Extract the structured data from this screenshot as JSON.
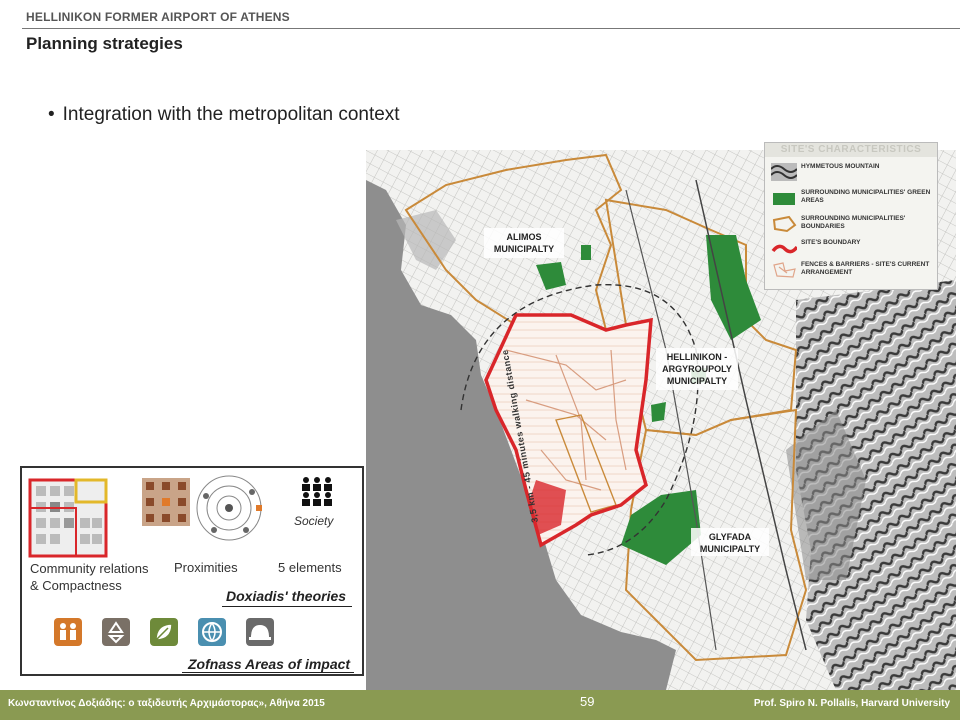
{
  "header": {
    "title": "HELLINIKON FORMER AIRPORT OF ATHENS",
    "subtitle": "Planning strategies"
  },
  "bullet": {
    "text": "Integration with the metropolitan context"
  },
  "map": {
    "labels": {
      "alimos": [
        "ALIMOS",
        "MUNICIPALTY"
      ],
      "hellinikon": [
        "HELLINIKON -",
        "ARGYROUPOLY",
        "MUNICIPALTY"
      ],
      "glyfada": [
        "GLYFADA",
        "MUNICIPALTY"
      ],
      "distance": "3,5 km - 45 minutes walking distance"
    },
    "legend": {
      "title": "SITE'S CHARACTERISTICS",
      "items": [
        {
          "label": "HYMMETOUS MOUNTAIN",
          "color": "#555555"
        },
        {
          "label": "SURROUNDING MUNICIPALITIES' GREEN AREAS",
          "color": "#2e8b3a"
        },
        {
          "label": "SURROUNDING MUNICIPALITIES' BOUNDARIES",
          "color": "#c98a3a"
        },
        {
          "label": "SITE'S BOUNDARY",
          "color": "#d9262a"
        },
        {
          "label": "FENCES & BARRIERS - SITE'S CURRENT ARRANGEMENT",
          "color": "#e0a58a"
        }
      ]
    }
  },
  "theories": {
    "items": [
      {
        "caption": "Community relations\n& Compactness"
      },
      {
        "caption": "Proximities"
      },
      {
        "caption": "5 elements",
        "icon_label": "Society"
      }
    ],
    "doxiadis_heading": "Doxiadis' theories",
    "zofnass_heading": "Zofnass Areas of impact",
    "impact_icons": [
      {
        "name": "people-icon",
        "color": "#d4782a"
      },
      {
        "name": "recycle-icon",
        "color": "#7a7066"
      },
      {
        "name": "leaf-icon",
        "color": "#6e8a3a"
      },
      {
        "name": "globe-icon",
        "color": "#4a8fb0"
      },
      {
        "name": "helmet-icon",
        "color": "#6a6a6a"
      }
    ]
  },
  "footer": {
    "left": "Κωνσταντίνος Δοξιάδης: ο ταξιδευτής Αρχιμάστορας», Αθήνα 2015",
    "page": "59",
    "right": "Prof. Spiro N. Pollalis, Harvard University"
  }
}
